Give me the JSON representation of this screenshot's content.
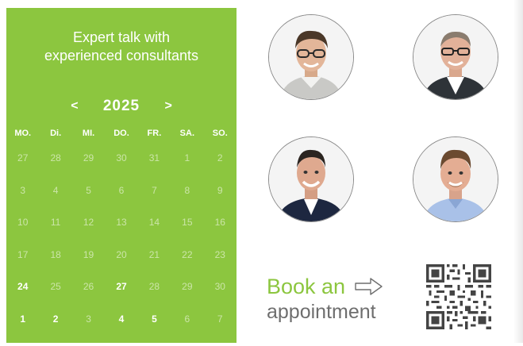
{
  "calendar": {
    "title_line1": "Expert talk with",
    "title_line2": "experienced consultants",
    "prev": "<",
    "next": ">",
    "year": "2025",
    "weekdays": [
      "MO.",
      "Di.",
      "MI.",
      "DO.",
      "FR.",
      "SA.",
      "SO."
    ],
    "weeks": [
      [
        "27",
        "28",
        "29",
        "30",
        "31",
        "1",
        "2"
      ],
      [
        "3",
        "4",
        "5",
        "6",
        "7",
        "8",
        "9"
      ],
      [
        "10",
        "11",
        "12",
        "13",
        "14",
        "15",
        "16"
      ],
      [
        "17",
        "18",
        "19",
        "20",
        "21",
        "22",
        "23"
      ],
      [
        "24",
        "25",
        "26",
        "27",
        "28",
        "29",
        "30"
      ],
      [
        "1",
        "2",
        "3",
        "4",
        "5",
        "6",
        "7"
      ]
    ]
  },
  "booking": {
    "line1": "Book an",
    "line2": "appointment"
  },
  "colors": {
    "accent": "#8cc63f",
    "muted_text": "#6e6e6e"
  },
  "icons": {
    "arrow": "arrow-right-outline-icon",
    "qr": "qr-code-icon"
  }
}
